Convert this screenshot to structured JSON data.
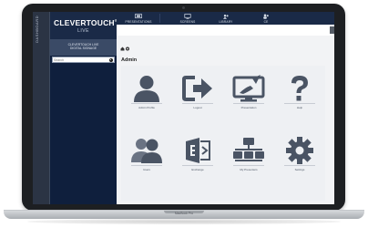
{
  "side_strip": {
    "label": "DASHBOARD"
  },
  "brand": {
    "title": "CLEVERTOUCH",
    "registered": "®",
    "subtitle": "LIVE"
  },
  "sidebar": {
    "header_line1": "CLEVERTOUCH LIVE",
    "header_line2": "DIGITAL SIGNAGE",
    "search_placeholder": "Search"
  },
  "topnav": {
    "tabs": [
      {
        "label": "PRESENTATIONS",
        "icon": "presentation-icon"
      },
      {
        "label": "SCREENS",
        "icon": "monitor-icon"
      },
      {
        "label": "LIBRARY",
        "icon": "library-icon"
      },
      {
        "label": "CE",
        "icon": "users-icon"
      }
    ]
  },
  "breadcrumb": {
    "icons": [
      "home-icon",
      "help-icon"
    ]
  },
  "admin": {
    "title": "Admin",
    "tiles": [
      {
        "label": "Admin Profile",
        "icon": "user-icon"
      },
      {
        "label": "Logout",
        "icon": "logout-icon"
      },
      {
        "label": "Presentation",
        "icon": "paint-monitor-icon"
      },
      {
        "label": "Help",
        "icon": "question-icon"
      },
      {
        "label": "Users",
        "icon": "users-group-icon"
      },
      {
        "label": "Exchange",
        "icon": "exchange-icon"
      },
      {
        "label": "My Presenters",
        "icon": "network-icon"
      },
      {
        "label": "Settings",
        "icon": "gear-icon"
      }
    ]
  },
  "device": {
    "model": "MacBook Pro"
  },
  "colors": {
    "sidebar": "#0f1f3d",
    "topnav": "#1a2a47",
    "icon": "#4a5464"
  }
}
